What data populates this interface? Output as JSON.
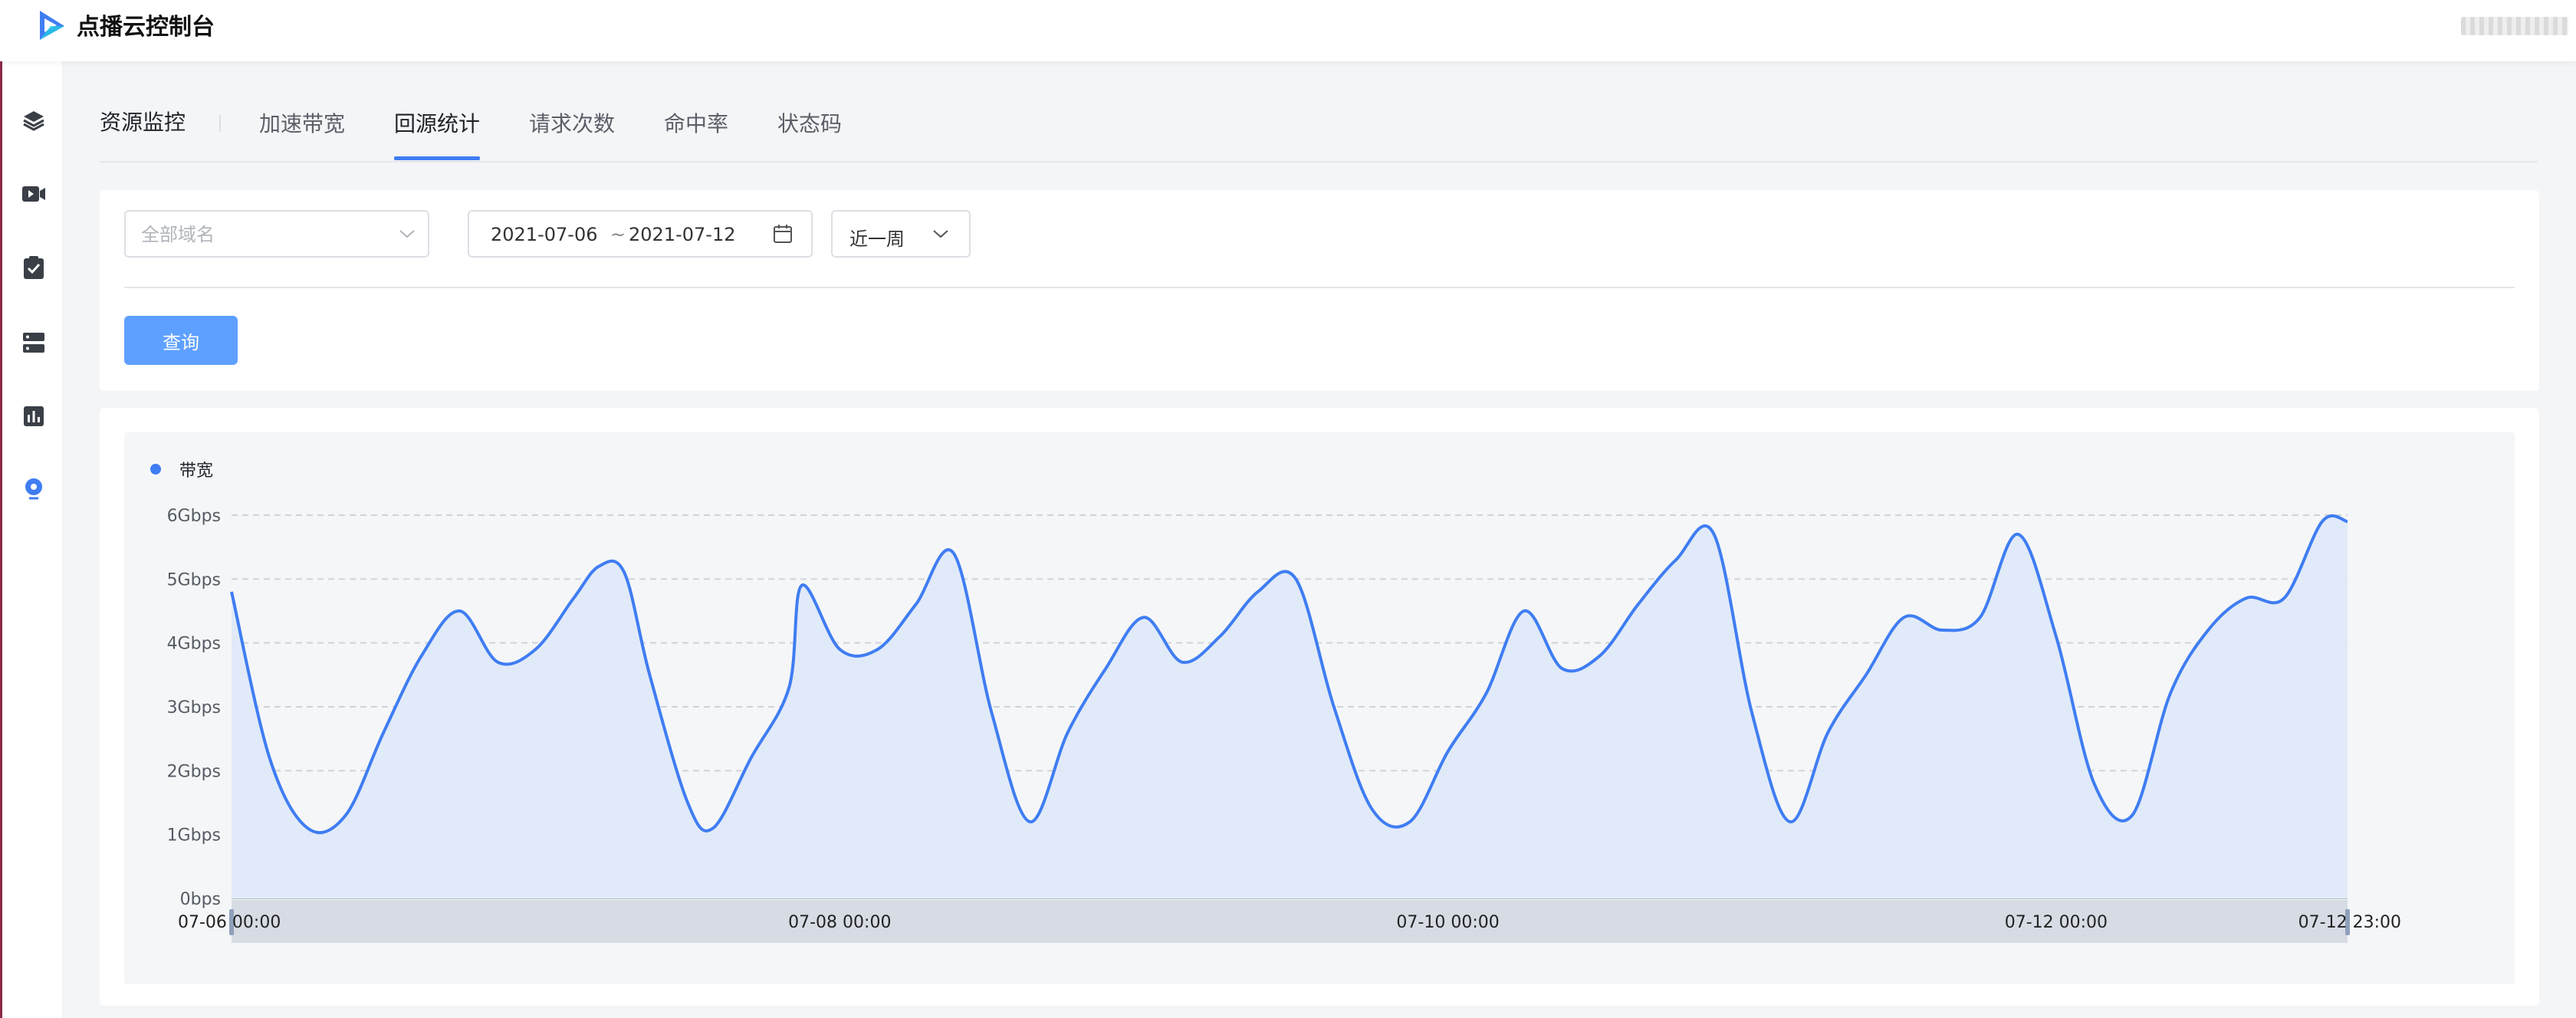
{
  "app": {
    "title": "点播云控制台"
  },
  "sidebar": {
    "items": [
      {
        "icon": "layers-icon"
      },
      {
        "icon": "video-icon"
      },
      {
        "icon": "clipboard-check-icon"
      },
      {
        "icon": "server-icon"
      },
      {
        "icon": "bar-chart-icon"
      },
      {
        "icon": "location-icon"
      }
    ]
  },
  "tabs": {
    "section_title": "资源监控",
    "items": [
      {
        "label": "加速带宽"
      },
      {
        "label": "回源统计",
        "active": true
      },
      {
        "label": "请求次数"
      },
      {
        "label": "命中率"
      },
      {
        "label": "状态码"
      }
    ]
  },
  "filters": {
    "domain_placeholder": "全部域名",
    "date_start": "2021-07-06",
    "date_separator": "~",
    "date_end": "2021-07-12",
    "period": "近一周",
    "query_label": "查询"
  },
  "colors": {
    "accent": "#3f7df2",
    "button": "#5ea0ff"
  },
  "chart_data": {
    "type": "area",
    "legend": [
      "带宽"
    ],
    "legend_position": "top-left",
    "grid": true,
    "y_ticks": [
      "0bps",
      "1Gbps",
      "2Gbps",
      "3Gbps",
      "4Gbps",
      "5Gbps",
      "6Gbps"
    ],
    "ylim": [
      0,
      6
    ],
    "x_ticks": [
      "07-06 00:00",
      "07-08 00:00",
      "07-10 00:00",
      "07-12 00:00",
      "07-12 23:00"
    ],
    "x_range_hours": [
      0,
      167
    ],
    "series": [
      {
        "name": "带宽",
        "x_hours": [
          0,
          3,
          6,
          9,
          12,
          15,
          18,
          21,
          24,
          27,
          29,
          31,
          33,
          36,
          38,
          41,
          44,
          45,
          48,
          51,
          54,
          57,
          60,
          63,
          66,
          69,
          72,
          75,
          78,
          81,
          84,
          87,
          90,
          93,
          96,
          99,
          102,
          105,
          108,
          111,
          114,
          117,
          120,
          123,
          126,
          129,
          132,
          135,
          138,
          141,
          144,
          147,
          150,
          153,
          156,
          159,
          162,
          165,
          167
        ],
        "values": [
          4.8,
          2.2,
          1.1,
          1.3,
          2.6,
          3.8,
          4.5,
          3.7,
          3.9,
          4.7,
          5.2,
          5.1,
          3.5,
          1.5,
          1.1,
          2.2,
          3.3,
          4.9,
          3.9,
          3.9,
          4.6,
          5.4,
          2.9,
          1.2,
          2.6,
          3.6,
          4.4,
          3.7,
          4.1,
          4.8,
          5.0,
          3.0,
          1.4,
          1.2,
          2.3,
          3.2,
          4.5,
          3.6,
          3.8,
          4.6,
          5.3,
          5.7,
          2.9,
          1.2,
          2.6,
          3.5,
          4.4,
          4.2,
          4.4,
          5.7,
          4.1,
          1.8,
          1.3,
          3.2,
          4.2,
          4.7,
          4.7,
          5.9,
          5.9
        ]
      }
    ]
  }
}
